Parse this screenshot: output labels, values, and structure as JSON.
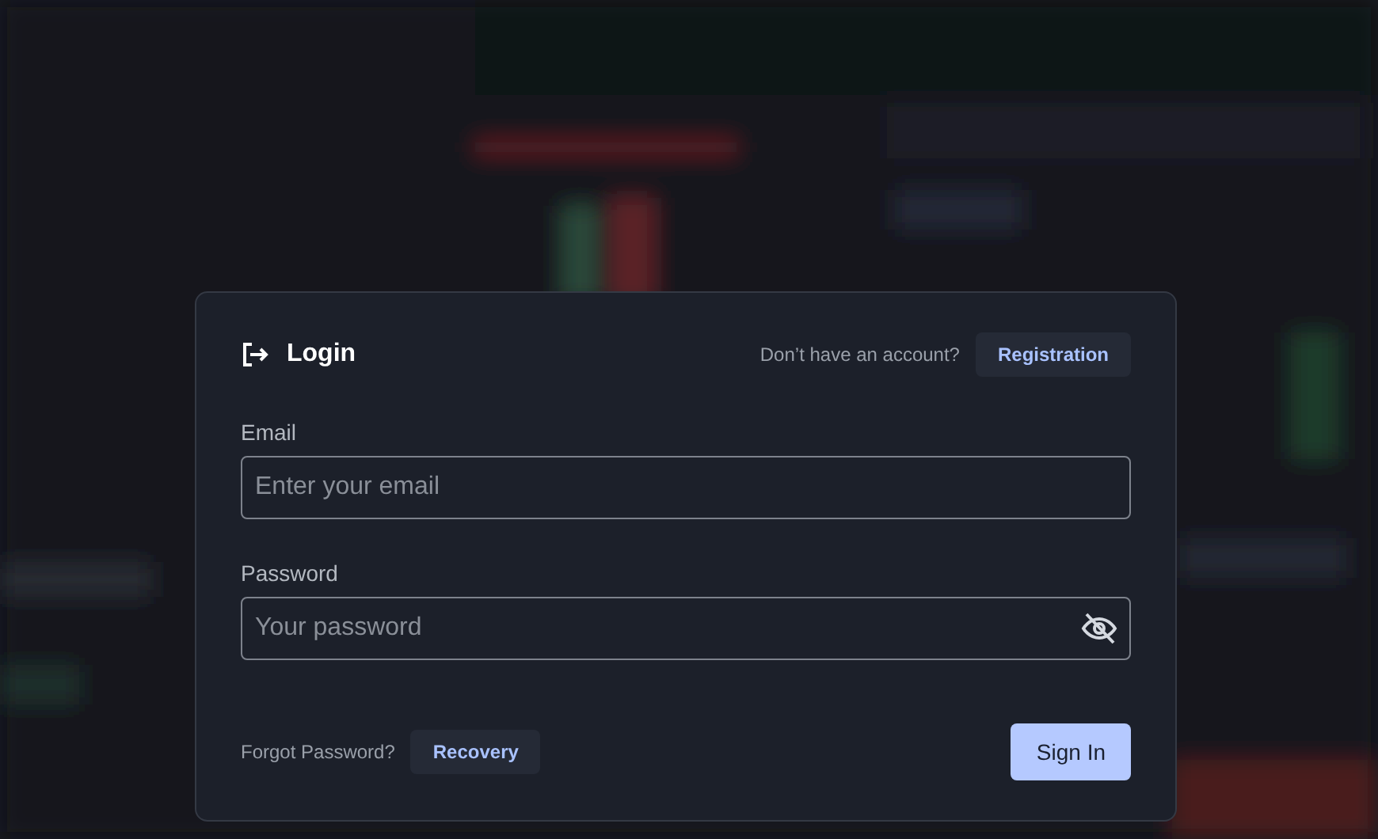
{
  "dialog": {
    "title": "Login",
    "prompt": "Don’t have an account?",
    "register_button": "Registration",
    "fields": [
      {
        "kind": "email",
        "label": "Email",
        "placeholder": "Enter your email"
      },
      {
        "kind": "password",
        "label": "Password",
        "placeholder": "Your password"
      }
    ],
    "forgot_text": "Forgot Password?",
    "recovery_button": "Recovery",
    "submit_button": "Sign In"
  }
}
